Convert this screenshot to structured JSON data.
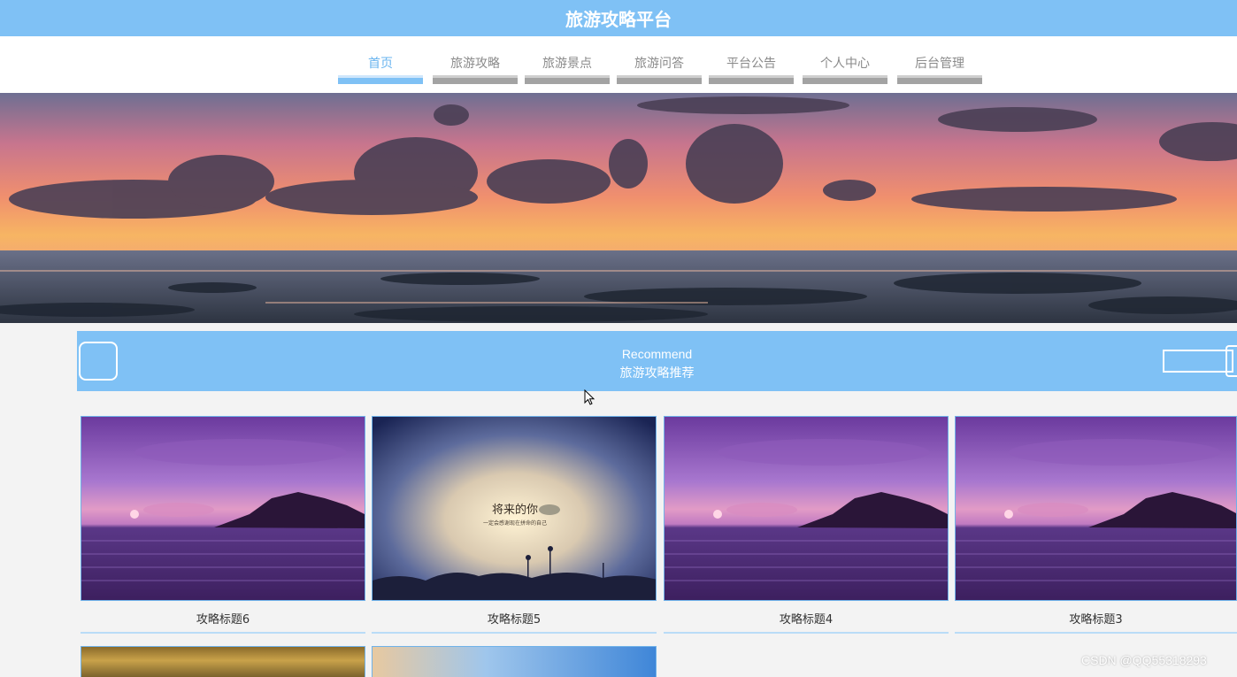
{
  "header": {
    "title": "旅游攻略平台"
  },
  "nav": {
    "items": [
      {
        "label": "首页",
        "active": true
      },
      {
        "label": "旅游攻略",
        "active": false
      },
      {
        "label": "旅游景点",
        "active": false
      },
      {
        "label": "旅游问答",
        "active": false
      },
      {
        "label": "平台公告",
        "active": false
      },
      {
        "label": "个人中心",
        "active": false
      },
      {
        "label": "后台管理",
        "active": false
      }
    ]
  },
  "section": {
    "title_en": "Recommend",
    "title_cn": "旅游攻略推荐"
  },
  "cards": [
    {
      "title": "攻略标题6",
      "image": "purple-sunset-sea-photo"
    },
    {
      "title": "攻略标题5",
      "image": "poster-photo",
      "poster_title": "将来的你",
      "poster_subtitle": "一定会感谢现在拼命的自己"
    },
    {
      "title": "攻略标题4",
      "image": "purple-sunset-sea-photo"
    },
    {
      "title": "攻略标题3",
      "image": "purple-sunset-sea-photo"
    }
  ],
  "watermark": "CSDN @QQ55318293",
  "colors": {
    "accent": "#7fc1f5",
    "nav_inactive": "#a3a3a3",
    "background": "#f3f3f3"
  }
}
